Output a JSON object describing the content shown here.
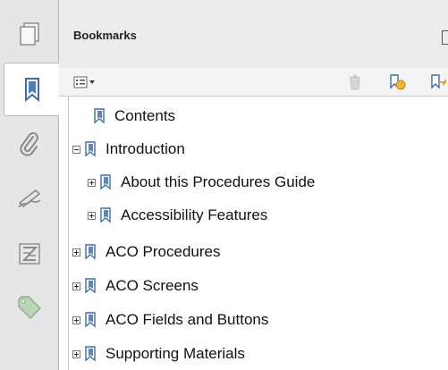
{
  "panel": {
    "title": "Bookmarks"
  },
  "rail": {
    "items": [
      {
        "icon": "page-thumbnails-icon",
        "active": false
      },
      {
        "icon": "bookmark-icon",
        "active": true
      },
      {
        "icon": "attachment-icon",
        "active": false
      },
      {
        "icon": "signature-icon",
        "active": false
      },
      {
        "icon": "layers-icon",
        "active": false
      },
      {
        "icon": "tag-icon",
        "active": false
      }
    ]
  },
  "toolbar": {
    "options_icon": "options-menu-icon",
    "delete_icon": "delete-icon",
    "new_bookmark_icon": "new-bookmark-icon",
    "expand_bookmark_icon": "expand-bookmark-icon"
  },
  "tree": {
    "items": [
      {
        "label": "Contents",
        "level": 0,
        "expander": "none"
      },
      {
        "label": "Introduction",
        "level": 0,
        "expander": "minus"
      },
      {
        "label": "About this Procedures Guide",
        "level": 1,
        "expander": "plus"
      },
      {
        "label": "Accessibility Features",
        "level": 1,
        "expander": "plus"
      },
      {
        "label": "ACO Procedures",
        "level": 0,
        "expander": "plus"
      },
      {
        "label": "ACO Screens",
        "level": 0,
        "expander": "plus"
      },
      {
        "label": "ACO Fields and Buttons",
        "level": 0,
        "expander": "plus"
      },
      {
        "label": "Supporting Materials",
        "level": 0,
        "expander": "plus"
      }
    ]
  },
  "colors": {
    "rail_bg": "#e6e6e6",
    "header_bg": "#ececec",
    "bookmark_blue": "#3f6fa6"
  }
}
